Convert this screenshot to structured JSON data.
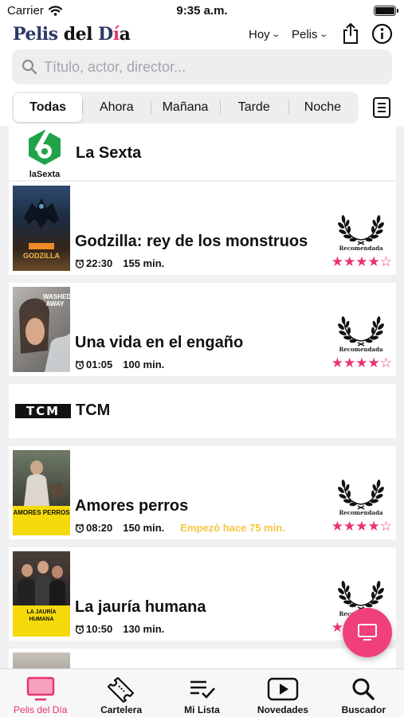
{
  "status_bar": {
    "carrier": "Carrier",
    "time": "9:35 a.m."
  },
  "header": {
    "logo_part1": "Pelis ",
    "logo_part2": "del ",
    "logo_part3": "D",
    "logo_part4": "í",
    "logo_part5": "a",
    "day_selector": "Hoy",
    "type_selector": "Pelis"
  },
  "search": {
    "placeholder": "Título, actor, director..."
  },
  "filters": {
    "tabs": [
      "Todas",
      "Ahora",
      "Mañana",
      "Tarde",
      "Noche"
    ],
    "active": "Todas"
  },
  "channels": [
    {
      "name": "La Sexta",
      "logo_text": "laSexta"
    },
    {
      "name": "TCM",
      "logo_text": "TCM"
    }
  ],
  "movies": [
    {
      "title": "Godzilla: rey de los monstruos",
      "time": "22:30",
      "duration": "155 min.",
      "badge": "Recomendada",
      "rating": "★★★★☆",
      "rating_value": 4,
      "poster_text": "GODZILLA"
    },
    {
      "title": "Una vida en el engaño",
      "time": "01:05",
      "duration": "100 min.",
      "badge": "Recomendada",
      "rating": "★★★★☆",
      "rating_value": 4,
      "poster_text": "WASHED AWAY"
    },
    {
      "title": "Amores perros",
      "time": "08:20",
      "duration": "150 min.",
      "started": "Empezó hace 75 min.",
      "badge": "Recomendada",
      "rating": "★★★★☆",
      "rating_value": 4,
      "poster_text": "AMORES PERROS"
    },
    {
      "title": "La jauría humana",
      "time": "10:50",
      "duration": "130 min.",
      "badge": "Recomendada",
      "rating": "★★★★☆",
      "rating_value": 4,
      "poster_text": "LA JAURÍA HUMANA"
    }
  ],
  "tabbar": {
    "items": [
      "Pelis del Día",
      "Cartelera",
      "Mi Lista",
      "Novedades",
      "Buscador"
    ],
    "active": "Pelis del Día"
  },
  "colors": {
    "accent": "#e8336d",
    "logo_blue": "#2b3a67",
    "started": "#f5c542",
    "fab": "#f0407a"
  }
}
